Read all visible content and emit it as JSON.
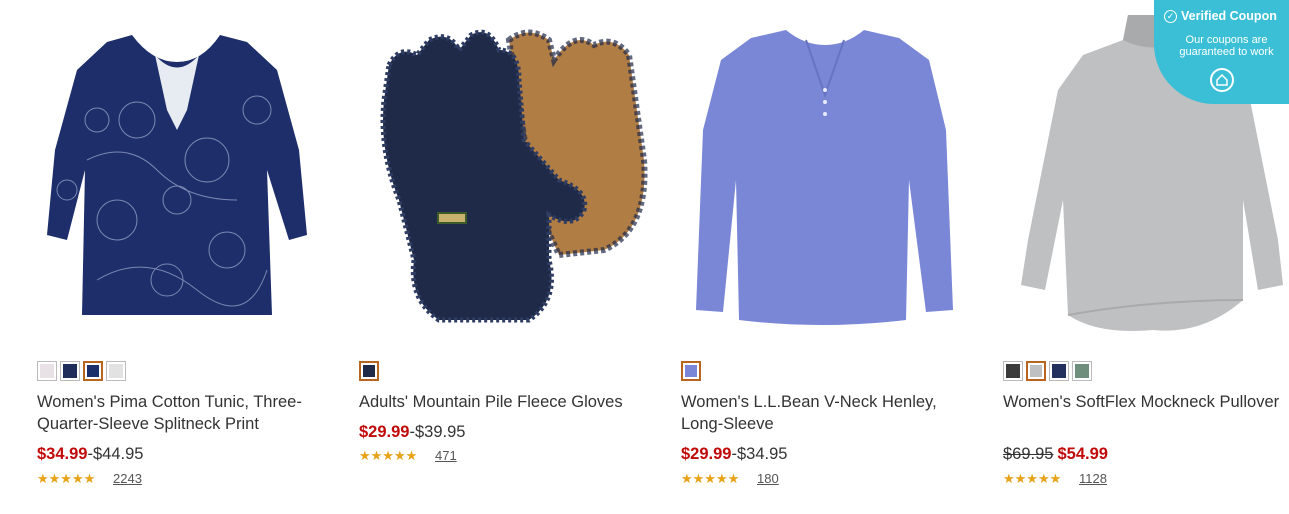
{
  "products": [
    {
      "title": "Women's Pima Cotton Tunic, Three-Quarter-Sleeve Splitneck Print",
      "price_sale": "$34.99",
      "price_sep": "-",
      "price_regular": "$44.95",
      "rating": 4.5,
      "review_count": "2243",
      "swatches": [
        {
          "name": "floral-white",
          "color": "#e8e2e6",
          "selected": false
        },
        {
          "name": "navy-print",
          "color": "#1e2d5a",
          "selected": false
        },
        {
          "name": "navy-floral",
          "color": "#1b2f6b",
          "selected": true
        },
        {
          "name": "light-gray",
          "color": "#e2e2e2",
          "selected": false
        }
      ]
    },
    {
      "title": "Adults' Mountain Pile Fleece Gloves",
      "price_sale": "$29.99",
      "price_sep": "-",
      "price_regular": "$39.95",
      "rating": 4.5,
      "review_count": "471",
      "swatches": [
        {
          "name": "navy",
          "color": "#1f2a48",
          "selected": true
        }
      ]
    },
    {
      "title": "Women's L.L.Bean V-Neck Henley, Long-Sleeve",
      "price_sale": "$29.99",
      "price_sep": "-",
      "price_regular": "$34.95",
      "rating": 4.5,
      "review_count": "180",
      "swatches": [
        {
          "name": "periwinkle",
          "color": "#7a86d6",
          "selected": true
        }
      ]
    },
    {
      "title": "Women's SoftFlex Mockneck Pullover",
      "price_original": "$69.95",
      "price_sale": "$54.99",
      "rating": 4.5,
      "review_count": "1128",
      "swatches": [
        {
          "name": "charcoal",
          "color": "#3b3b3b",
          "selected": false
        },
        {
          "name": "gray-heather",
          "color": "#bfc0c2",
          "selected": true
        },
        {
          "name": "navy",
          "color": "#24305e",
          "selected": false
        },
        {
          "name": "sage",
          "color": "#6f8f7c",
          "selected": false
        }
      ]
    }
  ],
  "coupon": {
    "title": "Verified Coupon",
    "subtitle": "Our coupons are guaranteed to work",
    "icon": "check-circle-icon",
    "color": "#3bbfd6"
  },
  "colors": {
    "sale_price": "#c10a0a",
    "star": "#e8a317",
    "swatch_selected_border": "#b8651f"
  }
}
